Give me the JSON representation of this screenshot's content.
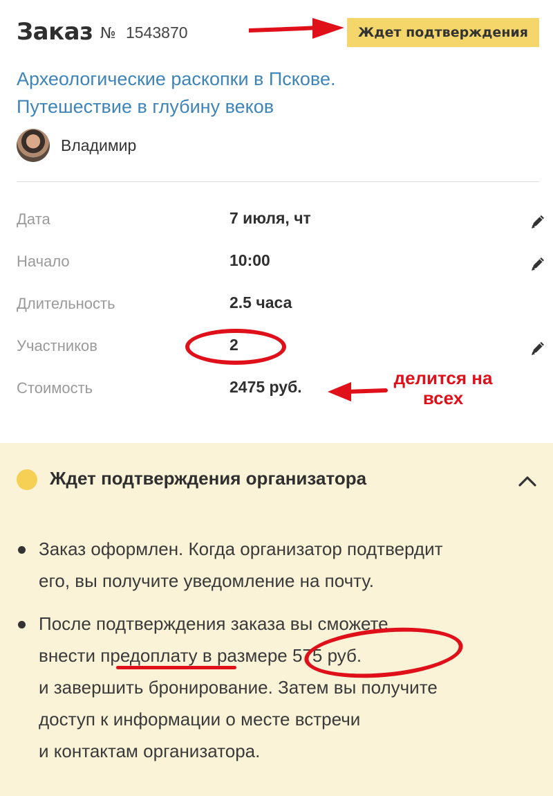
{
  "header": {
    "title": "Заказ",
    "number_sign": "№",
    "number": "1543870",
    "status": "Ждет подтверждения"
  },
  "tour": {
    "title_line1": "Археологические раскопки в Пскове.",
    "title_line2": "Путешествие в глубину веков"
  },
  "organizer": {
    "name": "Владимир"
  },
  "details": [
    {
      "label": "Дата",
      "value": "7 июля, чт",
      "editable": true
    },
    {
      "label": "Начало",
      "value": "10:00",
      "editable": true
    },
    {
      "label": "Длительность",
      "value": "2.5 часа",
      "editable": false
    },
    {
      "label": "Участников",
      "value": "2",
      "editable": true
    },
    {
      "label": "Стоимость",
      "value": "2475 руб.",
      "editable": false
    }
  ],
  "annotation": {
    "note_line1": "делится на",
    "note_line2": "всех"
  },
  "status_panel": {
    "title": "Ждет подтверждения организатора",
    "bullet1": [
      "Заказ оформлен. Когда организатор подтвердит",
      "его, вы получите уведомление на почту."
    ],
    "bullet2": [
      "После подтверждения заказа вы сможете",
      "внести предоплату в размере 575 руб.",
      "и завершить бронирование. Затем вы получите",
      "доступ к информации о месте встречи",
      "и контактам организатора."
    ]
  },
  "colors": {
    "accent_link": "#3f84b8",
    "badge": "#f5d66b",
    "panel_bg": "#fbf3d7",
    "annotation_red": "#e0101a"
  },
  "icons": {
    "edit": "pencil-icon",
    "collapse": "chevron-up-icon",
    "status": "dot-icon"
  }
}
